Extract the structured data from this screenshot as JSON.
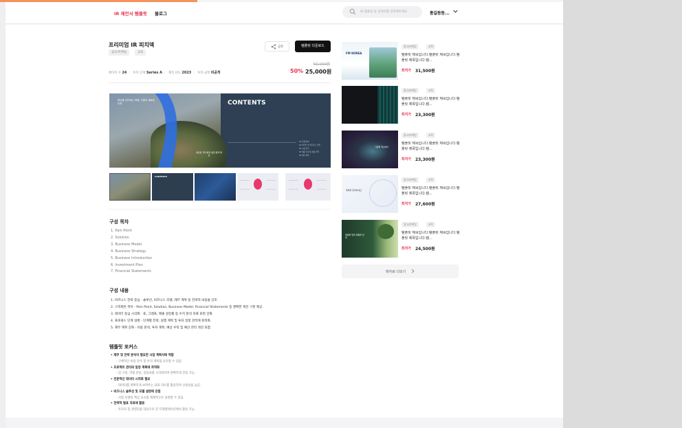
{
  "nav": {
    "active_link": "IR 제안서 템플릿",
    "blog_link": "블로그",
    "search_placeholder": "IR 템플릿 등 검색어를 입력해주세요",
    "user_name": "홍길동동..."
  },
  "product": {
    "title": "프리미엄 IR 피치덱",
    "tags": [
      "광고/마케팅",
      "교육"
    ],
    "share_label": "공유",
    "download_label": "템플릿 다운로드",
    "meta": [
      {
        "label": "페이지 수",
        "value": "24"
      },
      {
        "label": "투자 단계",
        "value": "Series A"
      },
      {
        "label": "제작 년도",
        "value": "2023"
      },
      {
        "label": "투자 금액",
        "value": "비공개"
      }
    ],
    "original_price": "50,000원",
    "discount": "50%",
    "price": "25,000원"
  },
  "hero": {
    "contents_title": "CONTENTS",
    "left_text": "혁신을 선도하는 미래, 기업의 새로운 도약",
    "caption": "새로운 기회 발견 성장 동력 확보",
    "list": [
      "01 문제 정의",
      "02 솔루션 및 비즈니스 모델",
      "03 시장 분석",
      "04 제품 소개 및 성장 전략",
      "05 재무 계획"
    ],
    "thumb2_title": "CONTENTS"
  },
  "sections": {
    "toc_title": "구성 목차",
    "toc_items": [
      "1. Pain Point",
      "2. Solution",
      "3. Business Model",
      "4. Business Strategy",
      "5. Business Introduction",
      "6. Investment Plan",
      "7. Financial Statements"
    ],
    "content_title": "구성 내용",
    "content_items": [
      "1. 비즈니스 전략 중심 - 솔루션, 비즈니스 모델, 재무 계획 등 전략적 내용을 강조.",
      "2. 구조화된 목차 - Pain Point, Solution, Business Model, Financial Statements 등 명확한 섹션 구분 제공.",
      "3. 데이터 중심 시각화 - 표, 그래프, 매출 성장률 등 수치 분석 자료 표현 강화.",
      "4. 프로세스 단계 설명 - 단계별 전략, 실행 계획 및 투자 일정 관리에 최적화.",
      "5. 재무 계획 강화 - 비용 분석, 투자 계획, 예상 수익 및 예산 관리 섹션 포함."
    ],
    "focus_title": "템플릿 포커스",
    "focus_items": [
      {
        "head": "• 재무 및 전략 분석이 필요한 사업 계획서에 적합",
        "sub": "- 구체적인 비용 분석 및 투자 계획을 강조할 수 있음."
      },
      {
        "head": "• 프로젝트 관리와 일정 계획에 최적화",
        "sub": "- 팀 구성, 역할 분담, 일정표를 시각화하여 명확하게 전달 가능."
      },
      {
        "head": "• 전문적인 데이터 시각화 필요",
        "sub": "- 데이터를 명확하게 보여주는 표와 차트를 활용하여 신뢰성을 높임."
      },
      {
        "head": "• 비즈니스 솔루션 및 모델 설명에 강점",
        "sub": "- 사업 모델의 핵심 요소를 체계적으로 설명할 수 있음."
      },
      {
        "head": "• 전략적 발표 자료에 활용",
        "sub": "- 투자자 및 경영진을 대상으로 한 프레젠테이션에서 활용 가능."
      }
    ]
  },
  "sidebar": {
    "cards": [
      {
        "tags": [
          "광고/마케팅",
          "교육"
        ],
        "desc": "템플릿 제목입니다.템플릿 제목입니다.템플릿 제목입니다.템...",
        "price_label": "최저가",
        "price": "31,500원",
        "img_text": "FM KOREA"
      },
      {
        "tags": [
          "광고/마케팅",
          "교육"
        ],
        "desc": "템플릿 제목입니다.템플릿 제목입니다.템플릿 제목입니다.템...",
        "price_label": "최저가",
        "price": "23,300원",
        "img_text": ""
      },
      {
        "tags": [
          "광고/마케팅",
          "교육"
        ],
        "desc": "템플릿 제목입니다.템플릿 제목입니다.템플릿 제목입니다.템...",
        "price_label": "최저가",
        "price": "23,300원",
        "img_text": "기업을 혁신하다"
      },
      {
        "tags": [
          "광고/마케팅",
          "교육"
        ],
        "desc": "템플릿 제목입니다.템플릿 제목입니다.템플릿 제목입니다.템...",
        "price_label": "최저가",
        "price": "27,600원",
        "img_text": "제목을 입력하세요"
      },
      {
        "tags": [
          "광고/마케팅",
          "교육"
        ],
        "desc": "템플릿 제목입니다.템플릿 제목입니다.템플릿 제목입니다.템...",
        "price_label": "최저가",
        "price": "24,500원",
        "img_text": "제목을 입력 제목을 입력"
      }
    ],
    "more_label": "매자료 더보기"
  },
  "colors": {
    "accent": "#e8344e",
    "top_bar": "#f5915a",
    "button_dark": "#111111"
  },
  "icons": {
    "search": "search-icon",
    "chevron_down": "chevron-down-icon",
    "share": "share-icon",
    "chevron_right": "chevron-right-icon"
  }
}
